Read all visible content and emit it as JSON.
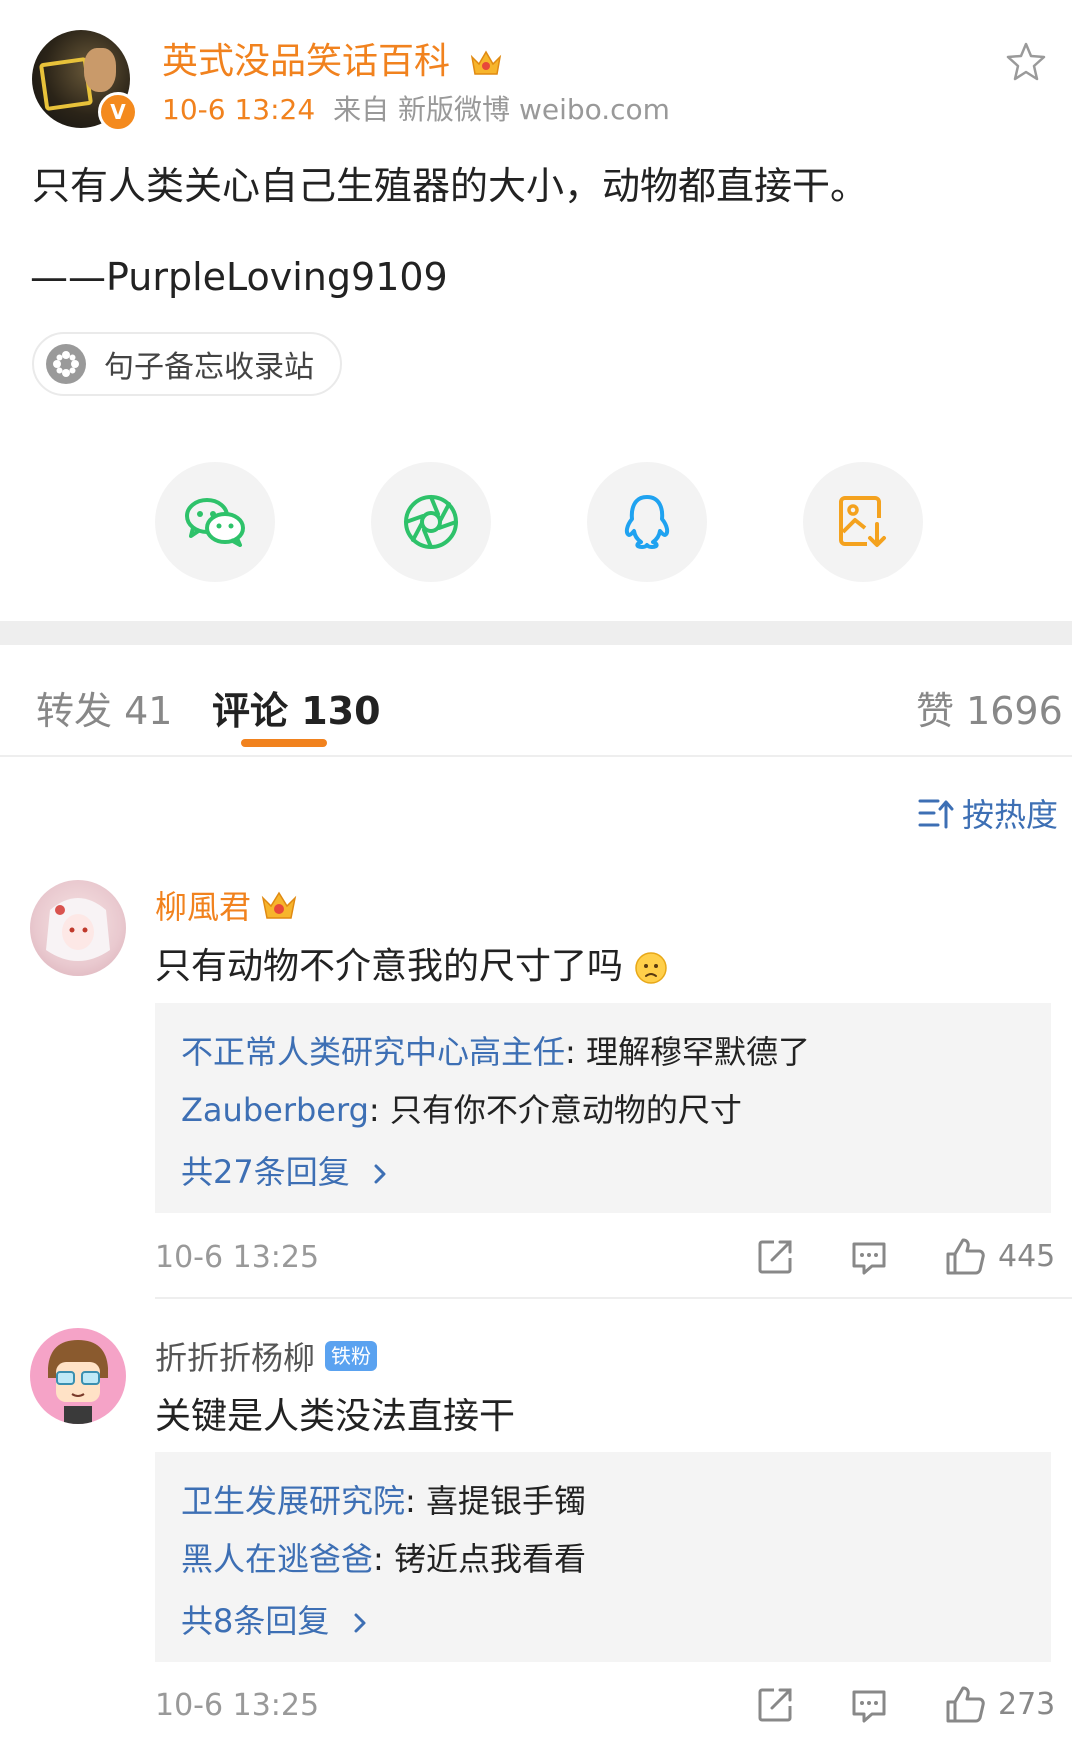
{
  "post": {
    "author": "英式没品笑话百科",
    "time": "10-6 13:24",
    "source": "来自 新版微博 weibo.com",
    "text": "只有人类关心自己生殖器的大小，动物都直接干。",
    "signature": "——PurpleLoving9109",
    "tag": "句子备忘收录站"
  },
  "share_buttons": [
    "wechat-icon",
    "moments-icon",
    "qq-icon",
    "save-image-icon"
  ],
  "tabs": {
    "repost": "转发 41",
    "comments": "评论 130",
    "likes": "赞 1696"
  },
  "sort_label": "按热度",
  "comments": [
    {
      "name": "柳風君",
      "text": "只有动物不介意我的尺寸了吗",
      "replies": [
        {
          "name": "不正常人类研究中心高主任",
          "text": ": 理解穆罕默德了"
        },
        {
          "name": "Zauberberg",
          "text": ": 只有你不介意动物的尺寸"
        }
      ],
      "more": "共27条回复",
      "time": "10-6 13:25",
      "likes": "445"
    },
    {
      "name": "折折折杨柳",
      "badge": "铁粉",
      "text": "关键是人类没法直接干",
      "replies": [
        {
          "name": "卫生发展研究院",
          "text": ": 喜提银手镯"
        },
        {
          "name": "黑人在逃爸爸",
          "text": ": 铐近点我看看"
        }
      ],
      "more": "共8条回复",
      "time": "10-6 13:25",
      "likes": "273"
    }
  ],
  "colors": {
    "accent": "#f1821e",
    "link": "#3d6fb4",
    "wechat": "#2ec26a",
    "qq": "#1fa2f0",
    "save": "#f4a21e"
  }
}
